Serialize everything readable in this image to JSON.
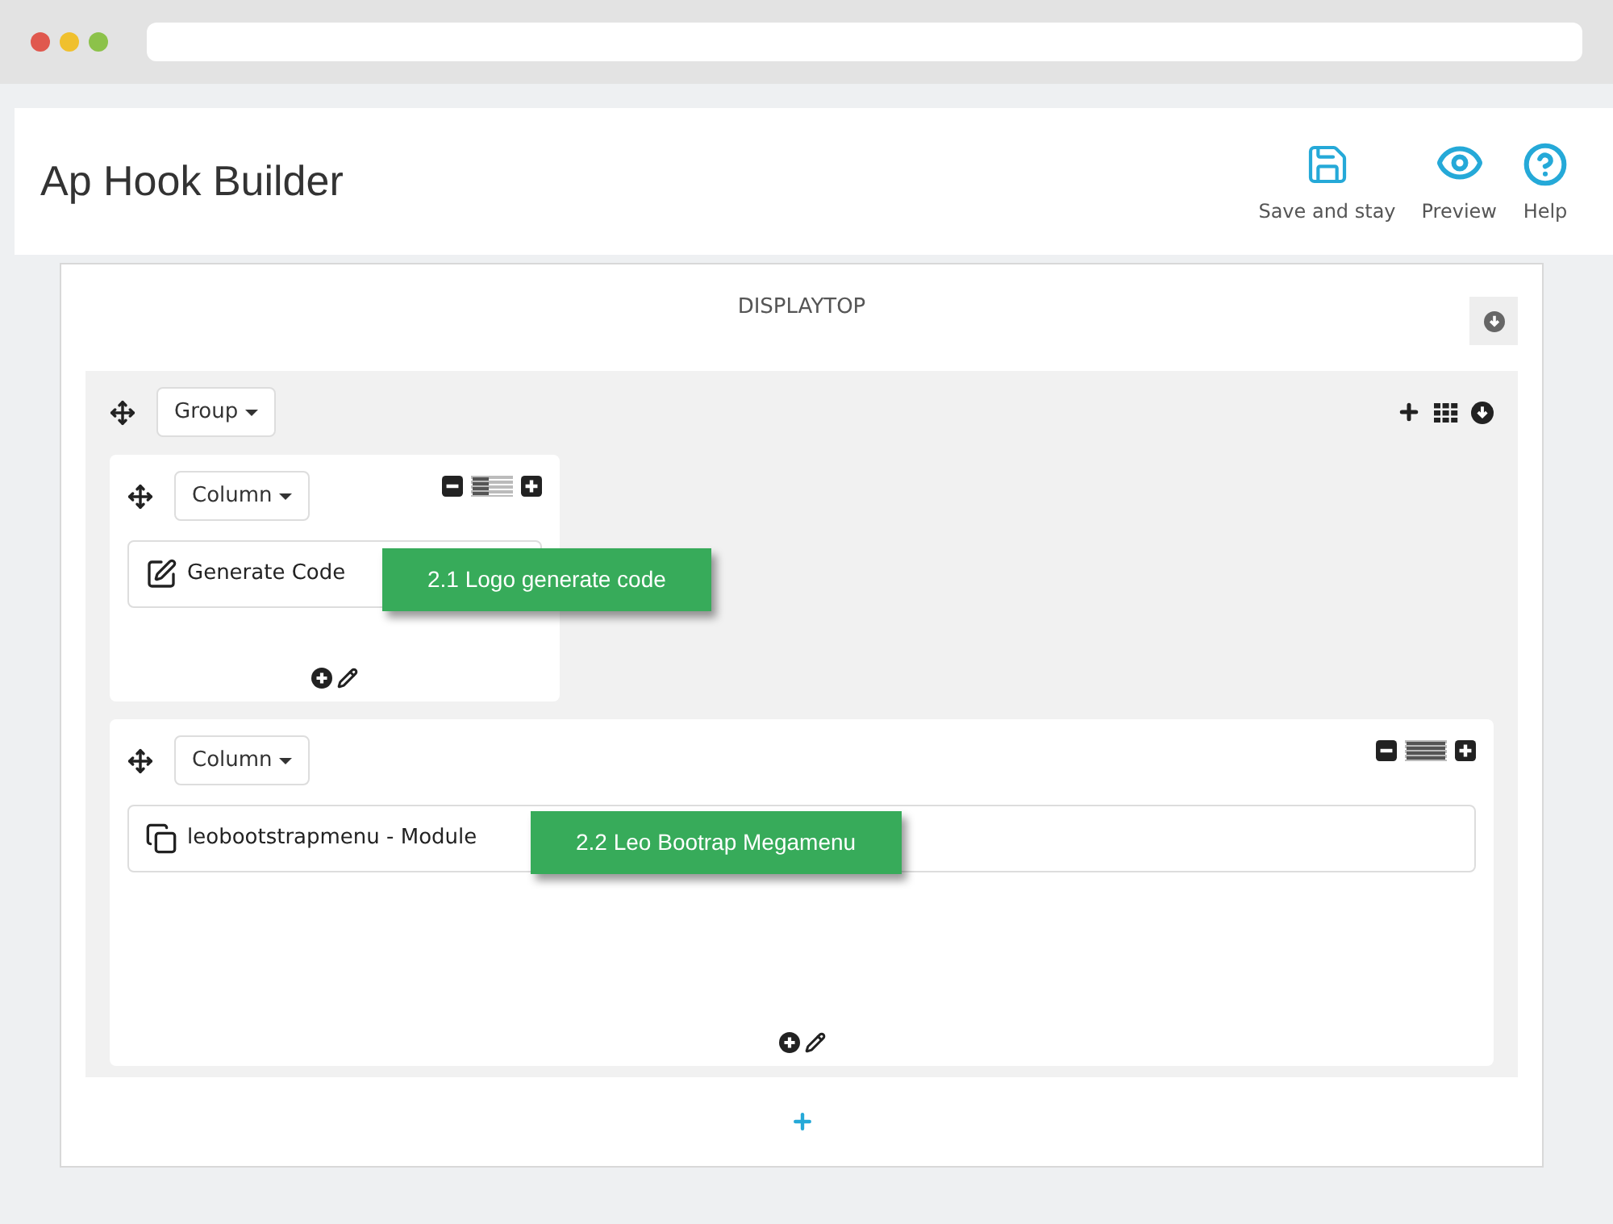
{
  "header": {
    "title": "Ap Hook Builder",
    "actions": [
      {
        "kind": "save",
        "label": "Save and stay"
      },
      {
        "kind": "preview",
        "label": "Preview"
      },
      {
        "kind": "help",
        "label": "Help"
      }
    ]
  },
  "hook": {
    "title": "DISPLAYTOP",
    "group": {
      "label": "Group",
      "columns": [
        {
          "label": "Column",
          "level": 0.4,
          "wide": false,
          "item": {
            "kind": "code",
            "label": "Generate Code"
          },
          "note": "2.1 Logo generate code"
        },
        {
          "label": "Column",
          "level": 1,
          "wide": true,
          "item": {
            "kind": "module",
            "label": "leobootstrapmenu - Module"
          },
          "note": "2.2 Leo Bootrap Megamenu"
        }
      ]
    }
  }
}
